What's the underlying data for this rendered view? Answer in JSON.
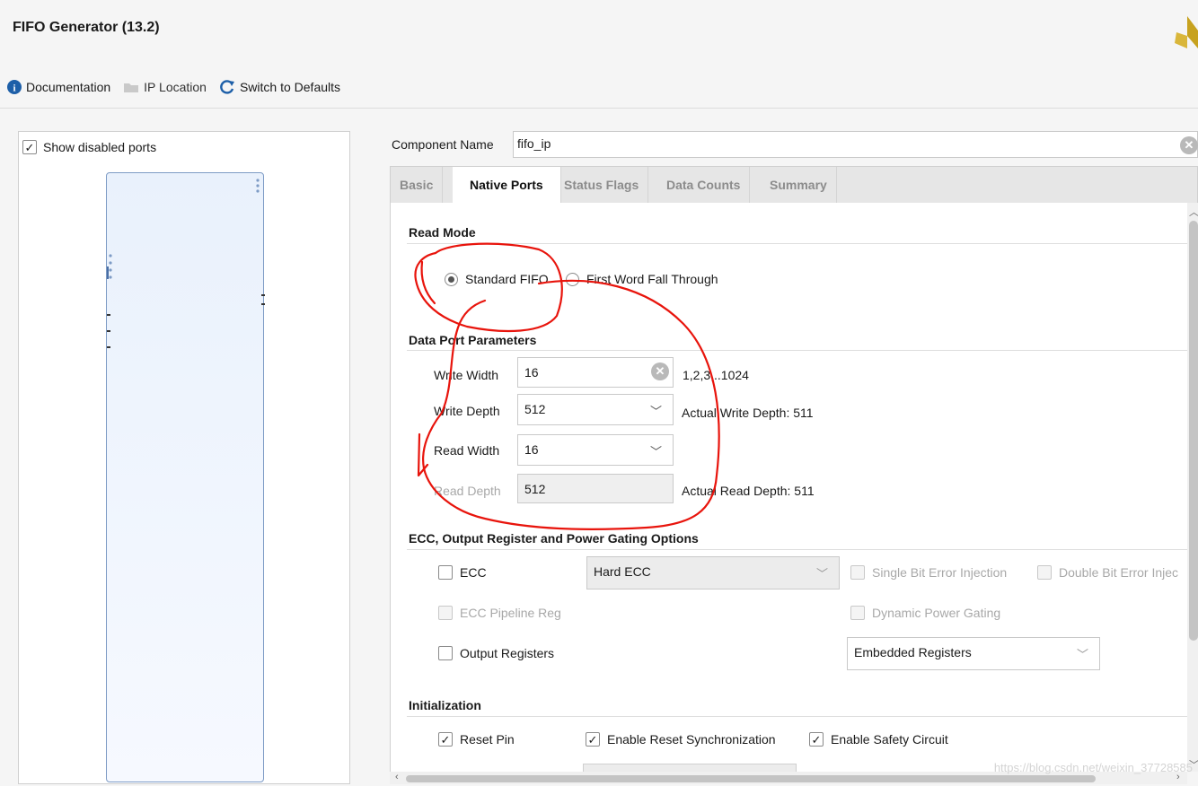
{
  "header": {
    "title": "FIFO Generator (13.2)"
  },
  "toolbar": {
    "documentation": "Documentation",
    "ip_location": "IP Location",
    "switch_defaults": "Switch to Defaults"
  },
  "left_panel": {
    "show_disabled_ports": "Show disabled ports",
    "show_disabled_checked": true
  },
  "component": {
    "label": "Component Name",
    "value": "fifo_ip"
  },
  "tabs": [
    {
      "label": "Basic",
      "active": false
    },
    {
      "label": "Native Ports",
      "active": true
    },
    {
      "label": "Status Flags",
      "active": false
    },
    {
      "label": "Data Counts",
      "active": false
    },
    {
      "label": "Summary",
      "active": false
    }
  ],
  "read_mode": {
    "heading": "Read Mode",
    "standard_fifo": "Standard FIFO",
    "first_word_fall_through": "First Word Fall Through",
    "selected": "Standard FIFO"
  },
  "data_port": {
    "heading": "Data Port Parameters",
    "write_width_label": "Write Width",
    "write_width_value": "16",
    "write_width_hint": "1,2,3,..1024",
    "write_depth_label": "Write Depth",
    "write_depth_value": "512",
    "write_depth_hint": "Actual Write Depth: 511",
    "read_width_label": "Read Width",
    "read_width_value": "16",
    "read_depth_label": "Read Depth",
    "read_depth_value": "512",
    "read_depth_hint": "Actual Read Depth: 511"
  },
  "ecc": {
    "heading": "ECC, Output Register and Power Gating Options",
    "ecc_label": "ECC",
    "ecc_type": "Hard ECC",
    "single_bit": "Single Bit Error Injection",
    "double_bit": "Double Bit Error Injec",
    "pipeline_reg": "ECC Pipeline Reg",
    "dynamic_power": "Dynamic Power Gating",
    "output_registers": "Output Registers",
    "register_type": "Embedded Registers"
  },
  "initialization": {
    "heading": "Initialization",
    "reset_pin": "Reset Pin",
    "reset_sync": "Enable Reset Synchronization",
    "safety_circuit": "Enable Safety Circuit",
    "check_mark": "✓"
  },
  "watermark": "https://blog.csdn.net/weixin_37728585",
  "colors": {
    "annotation": "#e8140c",
    "accent": "#1d6fb8"
  }
}
